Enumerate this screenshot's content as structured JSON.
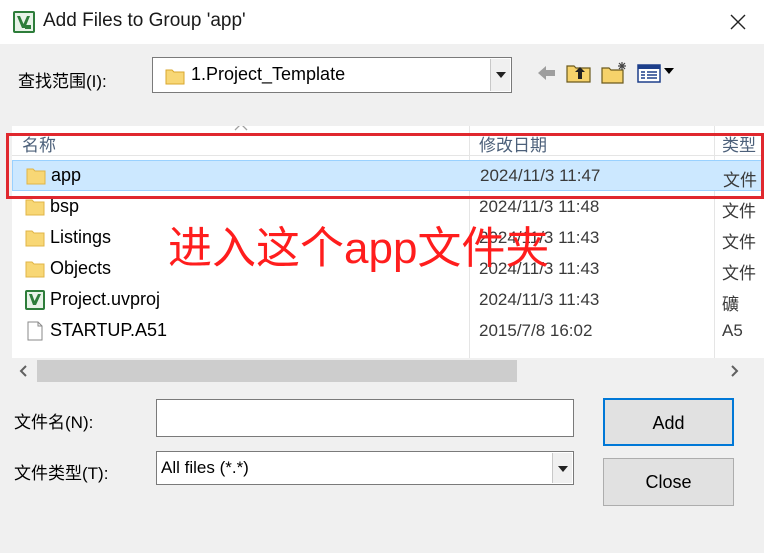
{
  "window": {
    "title": "Add Files to Group 'app'",
    "close_symbol": "✕",
    "app_icon": "keil-uvision-icon"
  },
  "lookin": {
    "label": "查找范围(I):",
    "value": "1.Project_Template",
    "toolbar": [
      "back-arrow-icon",
      "up-folder-icon",
      "new-folder-icon",
      "view-menu-icon"
    ]
  },
  "file_list": {
    "columns": [
      "名称",
      "修改日期",
      "类型"
    ],
    "rows": [
      {
        "name": "app",
        "date": "2024/11/3 11:47",
        "type": "文件",
        "icon": "folder-icon",
        "selected": true
      },
      {
        "name": "bsp",
        "date": "2024/11/3 11:48",
        "type": "文件",
        "icon": "folder-icon"
      },
      {
        "name": "Listings",
        "date": "2024/11/3 11:43",
        "type": "文件",
        "icon": "folder-icon"
      },
      {
        "name": "Objects",
        "date": "2024/11/3 11:43",
        "type": "文件",
        "icon": "folder-icon"
      },
      {
        "name": "Project.uvproj",
        "date": "2024/11/3 11:43",
        "type": "礦",
        "icon": "uvision-project-icon"
      },
      {
        "name": "STARTUP.A51",
        "date": "2015/7/8 16:02",
        "type": "A5",
        "icon": "file-icon"
      }
    ]
  },
  "filename": {
    "label": "文件名(N):",
    "value": ""
  },
  "filetype": {
    "label": "文件类型(T):",
    "value": "All files (*.*)"
  },
  "buttons": {
    "add": "Add",
    "close": "Close"
  },
  "annotation": {
    "text": "进入这个app文件夹",
    "color": "#ff1d1d"
  },
  "colors": {
    "selection": "#cce8ff",
    "folder": "#f8d775",
    "header_text": "#4c607a"
  }
}
